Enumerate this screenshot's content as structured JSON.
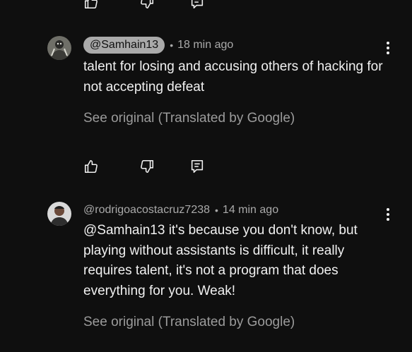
{
  "comments": [
    {
      "handle": "@Samhain13",
      "handle_style": "highlighted",
      "separator": "•",
      "time": "18 min ago",
      "text": "talent for losing and accusing others of hacking for not accepting defeat",
      "see_original": "See original (Translated by Google)"
    },
    {
      "handle": "@rodrigoacostacruz7238",
      "handle_style": "plain",
      "separator": "•",
      "time": "14 min ago",
      "text": "@Samhain13 it's because you don't know, but playing without assistants is difficult, it really requires talent, it's not a program that does everything for you. Weak!",
      "see_original": "See original (Translated by Google)"
    }
  ],
  "icons": {
    "like": "thumb-up-icon",
    "dislike": "thumb-down-icon",
    "reply": "reply-comment-icon",
    "menu": "more-vert-icon"
  },
  "colors": {
    "background": "#0f0f0f",
    "text": "#f1f1f1",
    "secondary": "#aaaaaa",
    "chip": "#aaaaaa"
  }
}
